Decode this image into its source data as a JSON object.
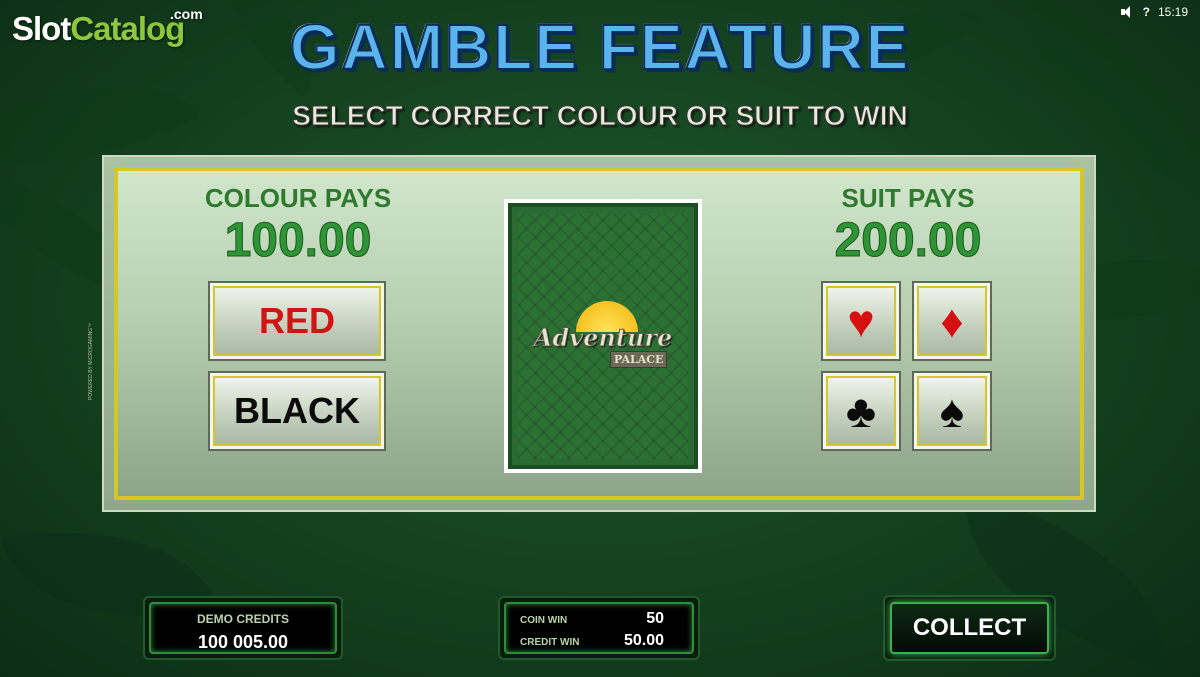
{
  "branding": {
    "slot": "Slot",
    "catalog": "Catalog",
    "com": ".com"
  },
  "status": {
    "help": "?",
    "time": "15:19",
    "sound_icon": "speaker-icon"
  },
  "title": "GAMBLE FEATURE",
  "subtitle": "SELECT CORRECT COLOUR OR SUIT TO WIN",
  "colour": {
    "label": "COLOUR PAYS",
    "value": "100.00",
    "buttons": {
      "red": "RED",
      "black": "BLACK"
    }
  },
  "suit": {
    "label": "SUIT PAYS",
    "value": "200.00",
    "buttons": {
      "hearts": "♥",
      "diamonds": "♦",
      "clubs": "♣",
      "spades": "♠"
    }
  },
  "card": {
    "logo_text": "Adventure",
    "logo_sub": "PALACE"
  },
  "side_text": "POWERED BY MICROGAMING™",
  "footer": {
    "credits_label": "DEMO CREDITS",
    "credits_value": "100 005.00",
    "coin_win_label": "COIN WIN",
    "coin_win_value": "50",
    "credit_win_label": "CREDIT WIN",
    "credit_win_value": "50.00",
    "collect_label": "COLLECT"
  },
  "colors": {
    "title": "#5ab3ea",
    "red": "#d11414",
    "pays_green": "#2f9436",
    "frame_gold": "#d6c728"
  }
}
